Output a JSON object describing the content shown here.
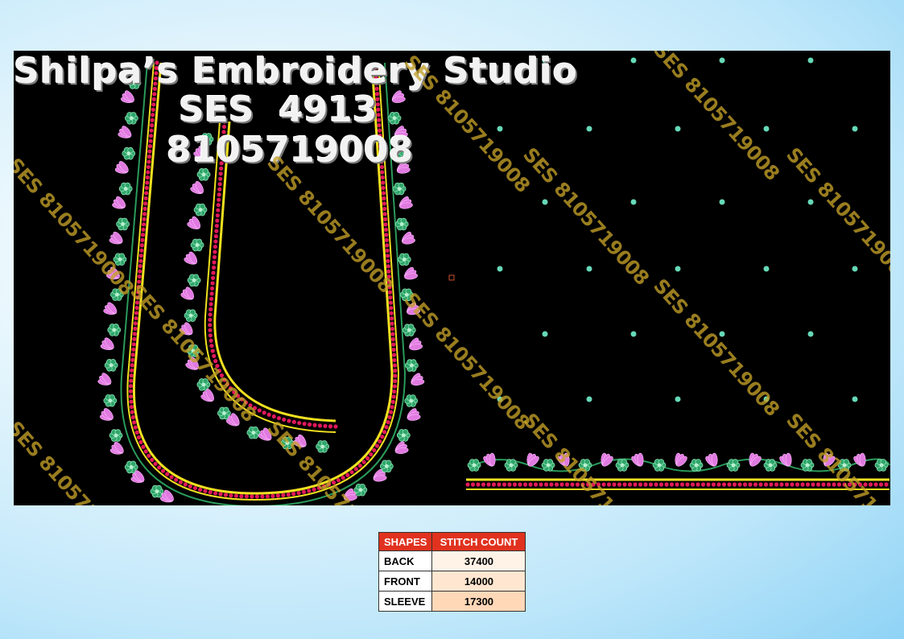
{
  "design": {
    "studio_name": "Shilpa’s Embroidery Studio",
    "design_code": "SES  4913",
    "phone": "8105719008",
    "watermark": "SES 8105719008"
  },
  "colors": {
    "canvas": "#000000",
    "leaf": "#e07ae0",
    "flower": "#2fa56a",
    "bead": "#e0185a",
    "gold_line": "#f0e020",
    "dot": "#66d9b8",
    "table_header": "#e0321e"
  },
  "table": {
    "headers": [
      "SHAPES",
      "STITCH COUNT"
    ],
    "rows": [
      {
        "shape": "BACK",
        "count": "37400"
      },
      {
        "shape": "FRONT",
        "count": "14000"
      },
      {
        "shape": "SLEEVE",
        "count": "17300"
      }
    ]
  }
}
